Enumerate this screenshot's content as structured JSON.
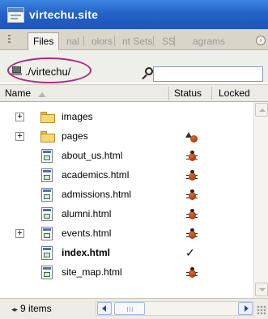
{
  "window": {
    "title": "virtechu.site"
  },
  "tabs": [
    "Files",
    "nal",
    "olors",
    "nt Sets",
    "SS",
    "agrams"
  ],
  "site": {
    "name": "./virtechu/",
    "search_placeholder": ""
  },
  "columns": {
    "name": "Name",
    "status": "Status",
    "locked": "Locked"
  },
  "files": [
    {
      "name": "images",
      "type": "folder",
      "expandable": true,
      "status": ""
    },
    {
      "name": "pages",
      "type": "folder",
      "expandable": true,
      "status": "bug-with-arrow-icon"
    },
    {
      "name": "about_us.html",
      "type": "file",
      "expandable": false,
      "status": "bug-icon"
    },
    {
      "name": "academics.html",
      "type": "file",
      "expandable": false,
      "status": "bug-icon"
    },
    {
      "name": "admissions.html",
      "type": "file",
      "expandable": false,
      "status": "bug-icon"
    },
    {
      "name": "alumni.html",
      "type": "file",
      "expandable": false,
      "status": "bug-icon"
    },
    {
      "name": "events.html",
      "type": "file",
      "expandable": true,
      "status": "bug-icon"
    },
    {
      "name": "index.html",
      "type": "file",
      "expandable": false,
      "status": "check-icon",
      "bold": true
    },
    {
      "name": "site_map.html",
      "type": "file",
      "expandable": false,
      "status": "bug-icon"
    }
  ],
  "footer": {
    "item_count": "9 items"
  },
  "symbols": {
    "expand": "+",
    "check": "✓",
    "arrows": "◂▸"
  }
}
